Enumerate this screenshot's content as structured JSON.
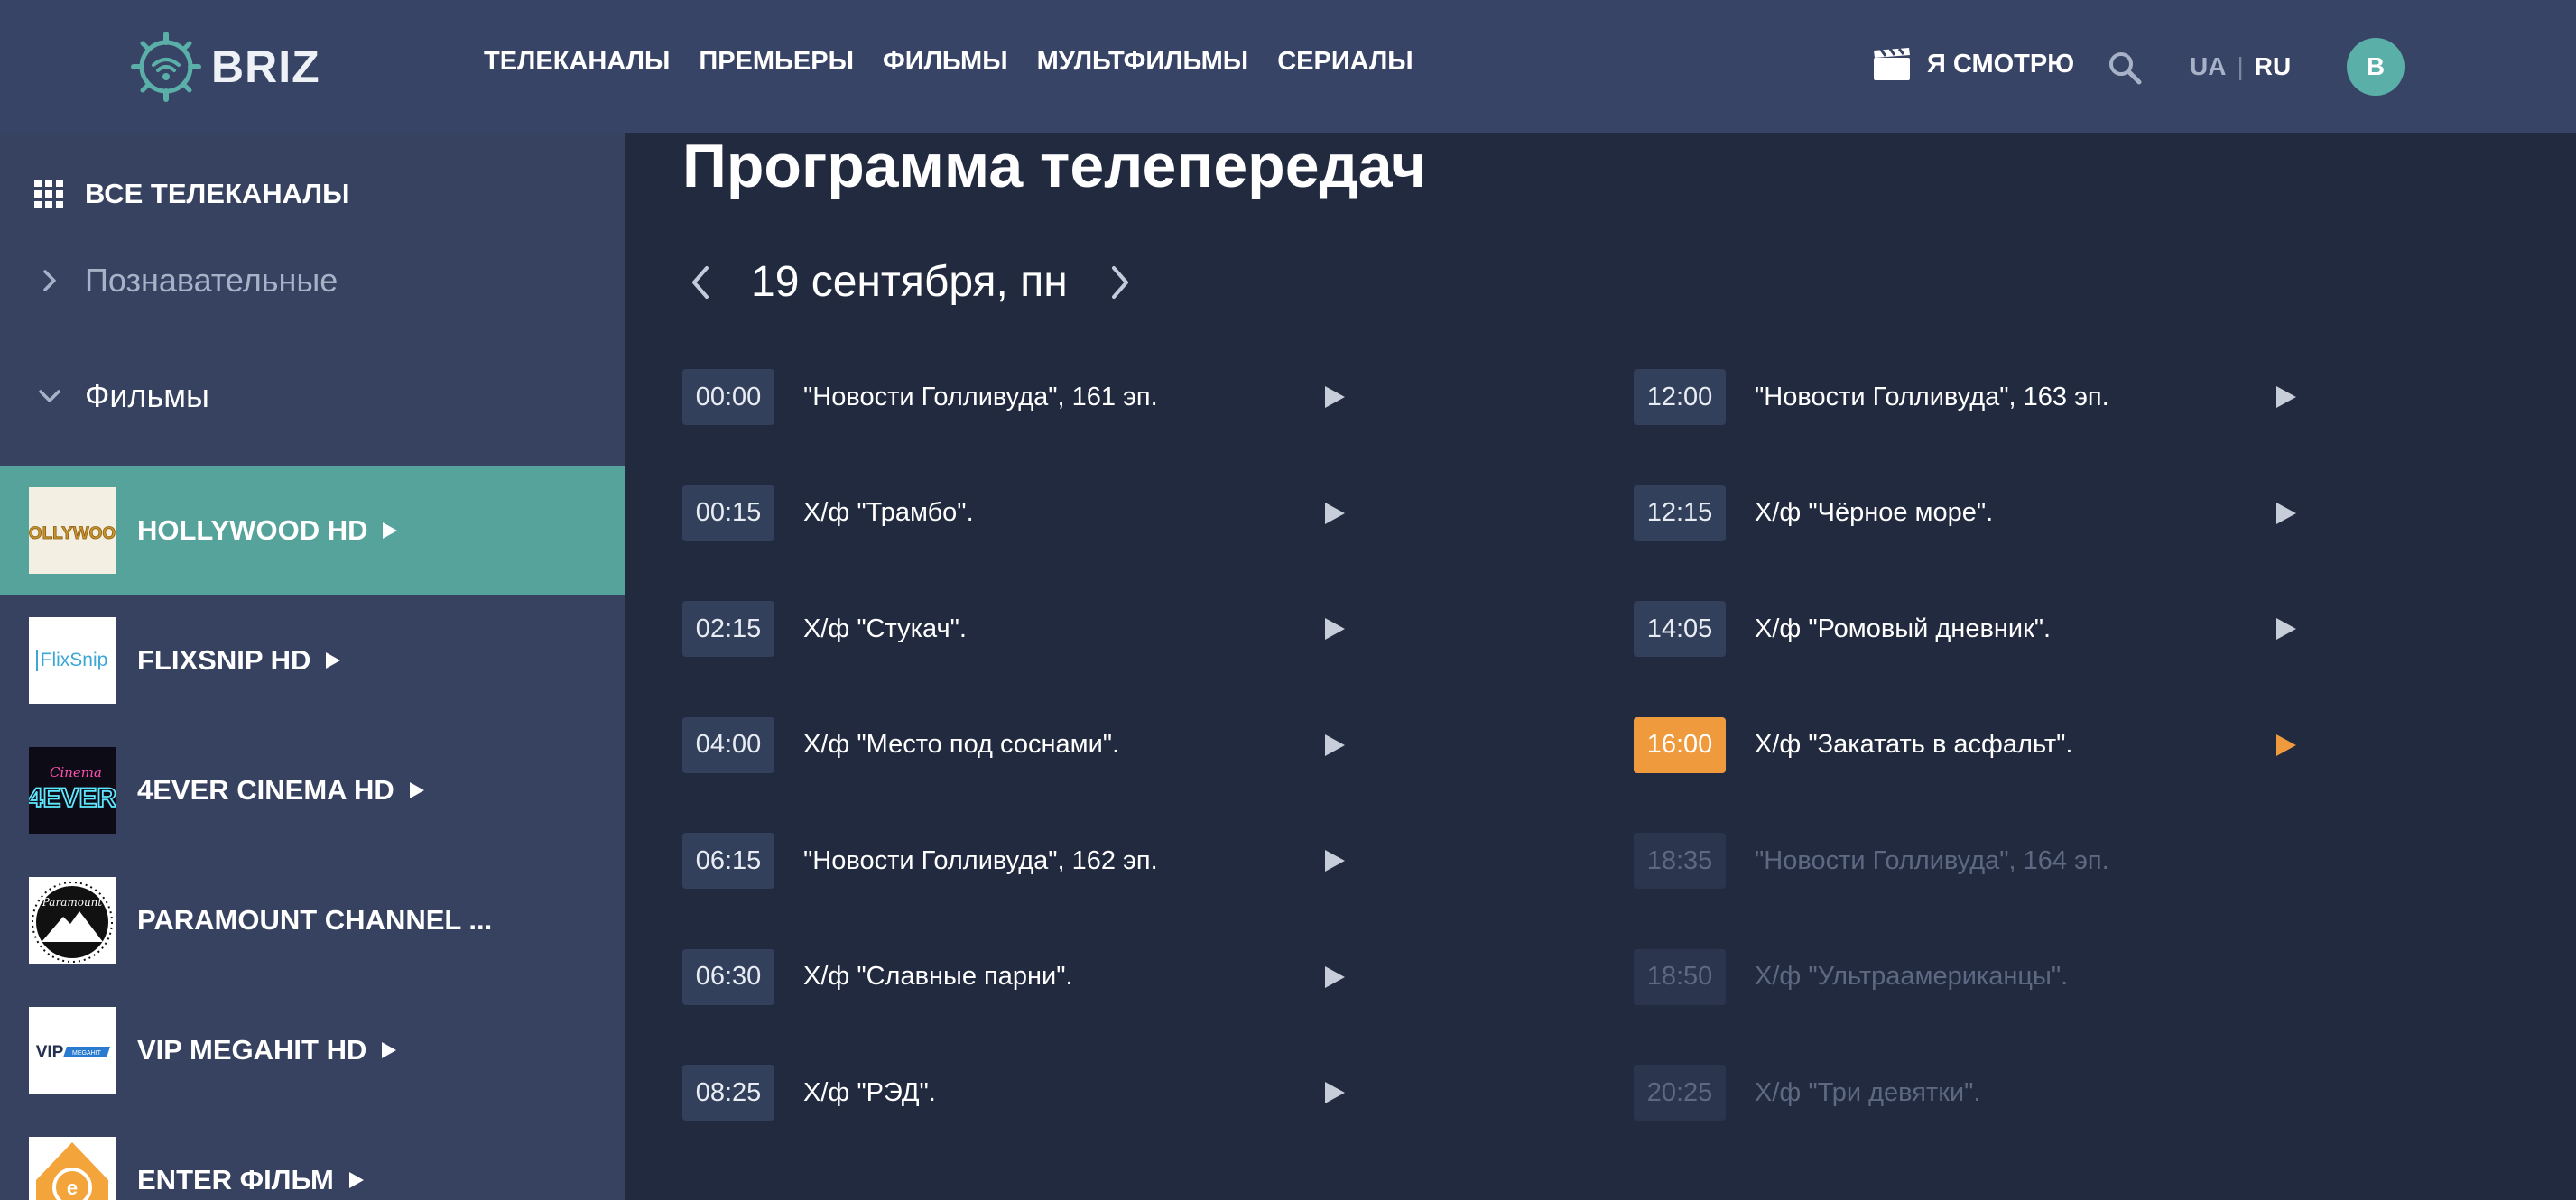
{
  "header": {
    "logo_text": "BRIZ",
    "nav": [
      "ТЕЛЕКАНАЛЫ",
      "ПРЕМЬЕРЫ",
      "ФИЛЬМЫ",
      "МУЛЬТФИЛЬМЫ",
      "СЕРИАЛЫ"
    ],
    "watching_label": "Я СМОТРЮ",
    "lang_ua": "UA",
    "lang_sep": "|",
    "lang_ru": "RU",
    "avatar_letter": "B",
    "accent_color": "#5ab0a8"
  },
  "sidebar": {
    "all_channels": "ВСЕ ТЕЛЕКАНАЛЫ",
    "categories": [
      {
        "label": "Познавательные",
        "state": "collapsed"
      },
      {
        "label": "Фильмы",
        "state": "expanded"
      }
    ],
    "channels": [
      {
        "name": "HOLLYWOOD HD",
        "active": true,
        "logo_text": "HOLLYWOOD",
        "playing": true
      },
      {
        "name": "FLIXSNIP HD",
        "active": false,
        "logo_text": "FlixSnip",
        "playing": true
      },
      {
        "name": "4EVER CINEMA HD",
        "active": false,
        "logo_text": "4EVER",
        "logo_sub": "Cinema",
        "playing": true
      },
      {
        "name": "PARAMOUNT CHANNEL ...",
        "active": false,
        "logo_text": "Paramount",
        "playing": false
      },
      {
        "name": "VIP MEGAHIT HD",
        "active": false,
        "logo_text": "VIP",
        "logo_sub": "MEGAHIT",
        "playing": true
      },
      {
        "name": "ENTER ФІЛЬМ",
        "active": false,
        "logo_text": "e",
        "playing": true
      }
    ]
  },
  "main": {
    "title": "Программа телепередач",
    "date": "19 сентября, пн",
    "now_color": "#f09a3e",
    "left": [
      {
        "time": "00:00",
        "title": "\"Новости Голливуда\", 161 эп.",
        "state": "past"
      },
      {
        "time": "00:15",
        "title": "Х/ф \"Трамбо\".",
        "state": "past"
      },
      {
        "time": "02:15",
        "title": "Х/ф \"Стукач\".",
        "state": "past"
      },
      {
        "time": "04:00",
        "title": "Х/ф \"Место под соснами\".",
        "state": "past"
      },
      {
        "time": "06:15",
        "title": "\"Новости Голливуда\", 162 эп.",
        "state": "past"
      },
      {
        "time": "06:30",
        "title": "Х/ф \"Славные парни\".",
        "state": "past"
      },
      {
        "time": "08:25",
        "title": "Х/ф \"РЭД\".",
        "state": "past"
      }
    ],
    "right": [
      {
        "time": "12:00",
        "title": "\"Новости Голливуда\", 163 эп.",
        "state": "past"
      },
      {
        "time": "12:15",
        "title": "Х/ф \"Чёрное море\".",
        "state": "past"
      },
      {
        "time": "14:05",
        "title": "Х/ф \"Ромовый дневник\".",
        "state": "past"
      },
      {
        "time": "16:00",
        "title": "Х/ф \"Закатать в асфальт\".",
        "state": "now"
      },
      {
        "time": "18:35",
        "title": "\"Новости Голливуда\", 164 эп.",
        "state": "future"
      },
      {
        "time": "18:50",
        "title": "Х/ф \"Ультраамериканцы\".",
        "state": "future"
      },
      {
        "time": "20:25",
        "title": "Х/ф \"Три девятки\".",
        "state": "future"
      }
    ]
  }
}
